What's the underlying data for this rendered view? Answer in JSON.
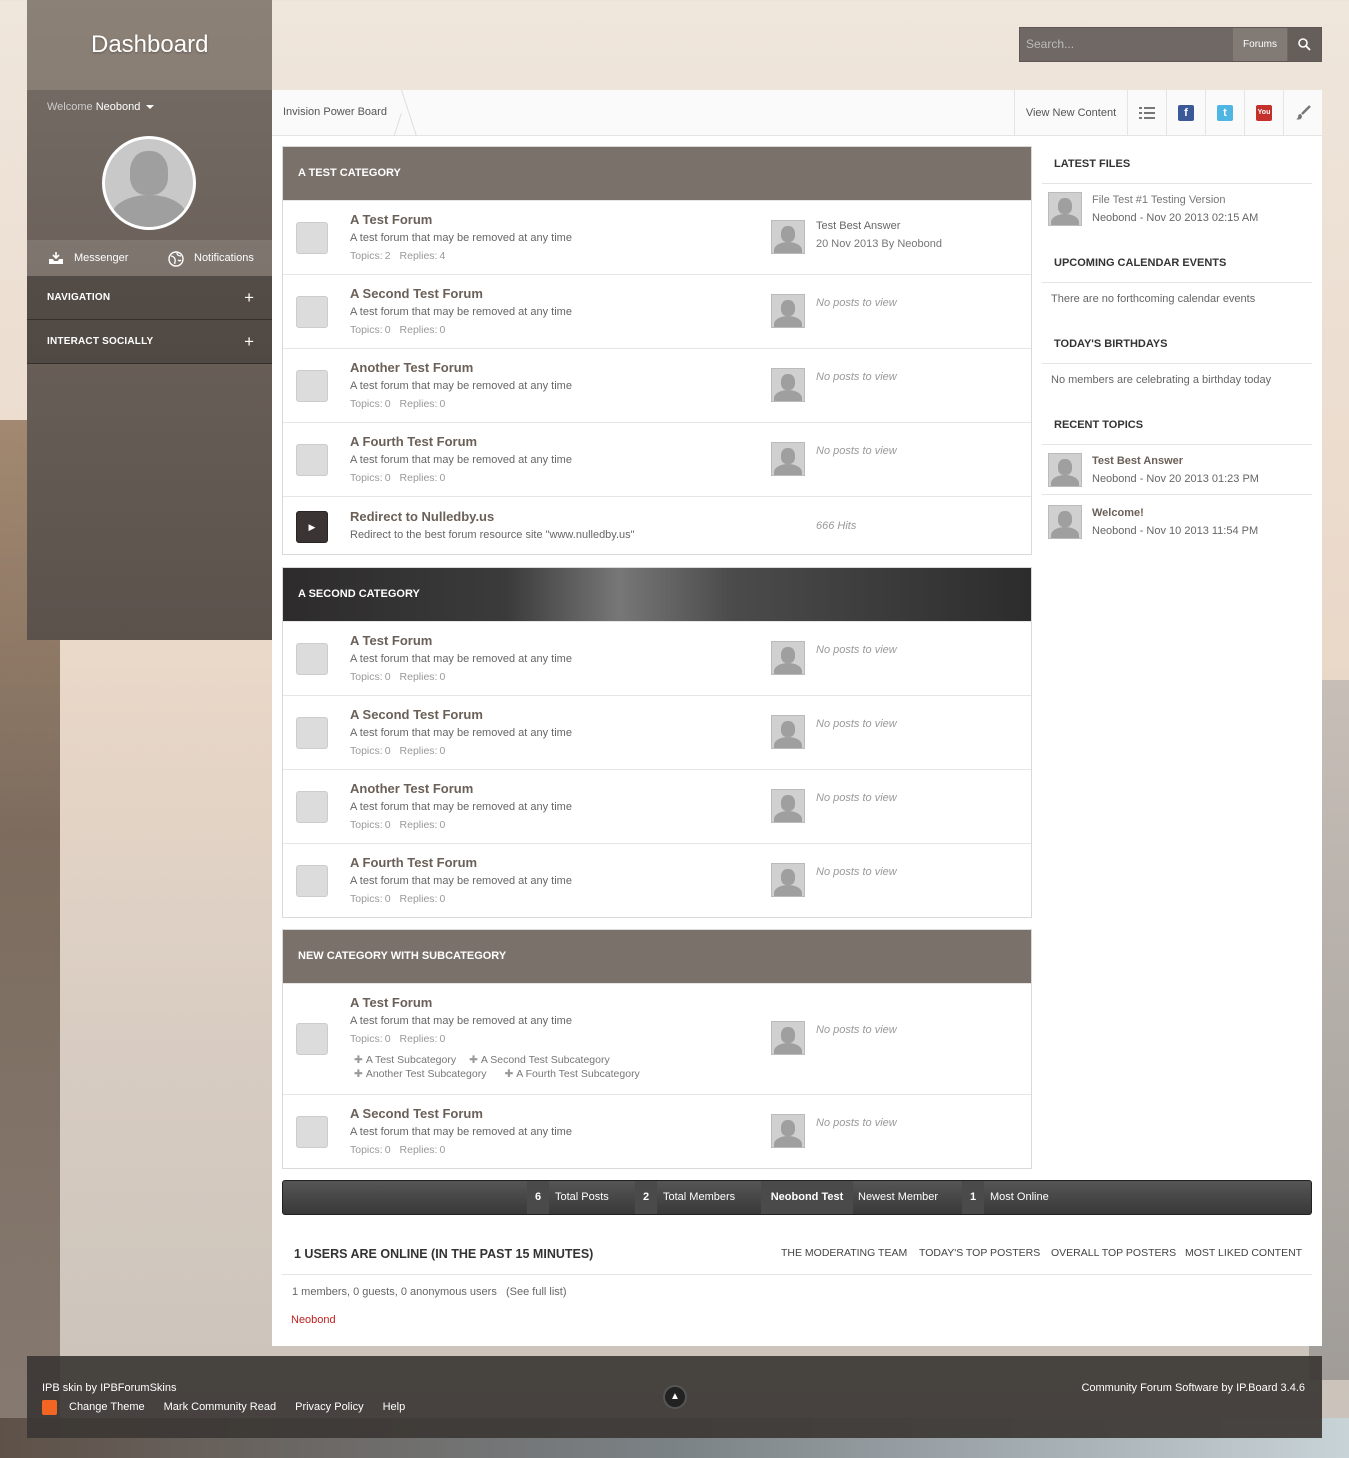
{
  "sidebar": {
    "brand": "Dashboard",
    "welcome_prefix": "Welcome",
    "username": "Neobond",
    "messenger": "Messenger",
    "notifications": "Notifications",
    "sections": [
      "NAVIGATION",
      "INTERACT SOCIALLY"
    ]
  },
  "search": {
    "placeholder": "Search...",
    "scope": "Forums"
  },
  "header": {
    "breadcrumb": "Invision Power Board",
    "view_new": "View New Content",
    "icons": [
      "list-icon",
      "facebook-icon",
      "twitter-icon",
      "youtube-icon",
      "brush-icon"
    ]
  },
  "categories": [
    {
      "title": "A TEST CATEGORY",
      "forums": [
        {
          "title": "A Test Forum",
          "desc": "A test forum that may be removed at any time",
          "topics_label": "Topics:",
          "topics": "2",
          "replies_label": "Replies:",
          "replies": "4",
          "last_title": "Test Best Answer",
          "last_by": "20 Nov 2013 By Neobond"
        },
        {
          "title": "A Second Test Forum",
          "desc": "A test forum that may be removed at any time",
          "topics_label": "Topics:",
          "topics": "0",
          "replies_label": "Replies:",
          "replies": "0",
          "last": "No posts to view"
        },
        {
          "title": "Another Test Forum",
          "desc": "A test forum that may be removed at any time",
          "topics_label": "Topics:",
          "topics": "0",
          "replies_label": "Replies:",
          "replies": "0",
          "last": "No posts to view"
        },
        {
          "title": "A Fourth Test Forum",
          "desc": "A test forum that may be removed at any time",
          "topics_label": "Topics:",
          "topics": "0",
          "replies_label": "Replies:",
          "replies": "0",
          "last": "No posts to view"
        },
        {
          "title": "Redirect to Nulledby.us",
          "desc": "Redirect to the best forum resource site \"www.nulledby.us\"",
          "hits": "666 Hits"
        }
      ]
    },
    {
      "title": "A SECOND CATEGORY",
      "forums": [
        {
          "title": "A Test Forum",
          "desc": "A test forum that may be removed at any time",
          "topics_label": "Topics:",
          "topics": "0",
          "replies_label": "Replies:",
          "replies": "0",
          "last": "No posts to view"
        },
        {
          "title": "A Second Test Forum",
          "desc": "A test forum that may be removed at any time",
          "topics_label": "Topics:",
          "topics": "0",
          "replies_label": "Replies:",
          "replies": "0",
          "last": "No posts to view"
        },
        {
          "title": "Another Test Forum",
          "desc": "A test forum that may be removed at any time",
          "topics_label": "Topics:",
          "topics": "0",
          "replies_label": "Replies:",
          "replies": "0",
          "last": "No posts to view"
        },
        {
          "title": "A Fourth Test Forum",
          "desc": "A test forum that may be removed at any time",
          "topics_label": "Topics:",
          "topics": "0",
          "replies_label": "Replies:",
          "replies": "0",
          "last": "No posts to view"
        }
      ]
    },
    {
      "title": "NEW CATEGORY WITH SUBCATEGORY",
      "forums": [
        {
          "title": "A Test Forum",
          "desc": "A test forum that may be removed at any time",
          "topics_label": "Topics:",
          "topics": "0",
          "replies_label": "Replies:",
          "replies": "0",
          "last": "No posts to view",
          "subforums": [
            "A Test Subcategory",
            "A Second Test Subcategory",
            "Another Test Subcategory",
            "A Fourth Test Subcategory"
          ]
        },
        {
          "title": "A Second Test Forum",
          "desc": "A test forum that may be removed at any time",
          "topics_label": "Topics:",
          "topics": "0",
          "replies_label": "Replies:",
          "replies": "0",
          "last": "No posts to view"
        }
      ]
    }
  ],
  "right": {
    "latest_files_title": "LATEST FILES",
    "latest_file": "File Test #1 Testing Version",
    "latest_file_meta": "Neobond - Nov 20 2013 02:15 AM",
    "calendar_title": "UPCOMING CALENDAR EVENTS",
    "calendar_text": "There are no forthcoming calendar events",
    "birthdays_title": "TODAY'S BIRTHDAYS",
    "birthdays_text": "No members are celebrating a birthday today",
    "recent_title": "RECENT TOPICS",
    "recent": [
      {
        "title": "Test Best Answer",
        "meta": "Neobond - Nov 20 2013 01:23 PM"
      },
      {
        "title": "Welcome!",
        "meta": "Neobond - Nov 10 2013 11:54 PM"
      }
    ]
  },
  "stats": {
    "posts_n": "6",
    "posts_l": "Total Posts",
    "members_n": "2",
    "members_l": "Total Members",
    "newest_n": "Neobond Test",
    "newest_l": "Newest Member",
    "online_n": "1",
    "online_l": "Most Online"
  },
  "online": {
    "title": "1 USERS ARE ONLINE (IN THE PAST 15 MINUTES)",
    "links": [
      "THE MODERATING TEAM",
      "TODAY'S TOP POSTERS",
      "OVERALL TOP POSTERS",
      "MOST LIKED CONTENT"
    ],
    "summary": "1 members, 0 guests, 0 anonymous users",
    "full_list": "(See full list)",
    "user": "Neobond"
  },
  "footer": {
    "skin": "IPB skin by IPBForumSkins",
    "links": [
      "Change Theme",
      "Mark Community Read",
      "Privacy Policy",
      "Help"
    ],
    "right": "Community Forum Software by IP.Board 3.4.6"
  }
}
